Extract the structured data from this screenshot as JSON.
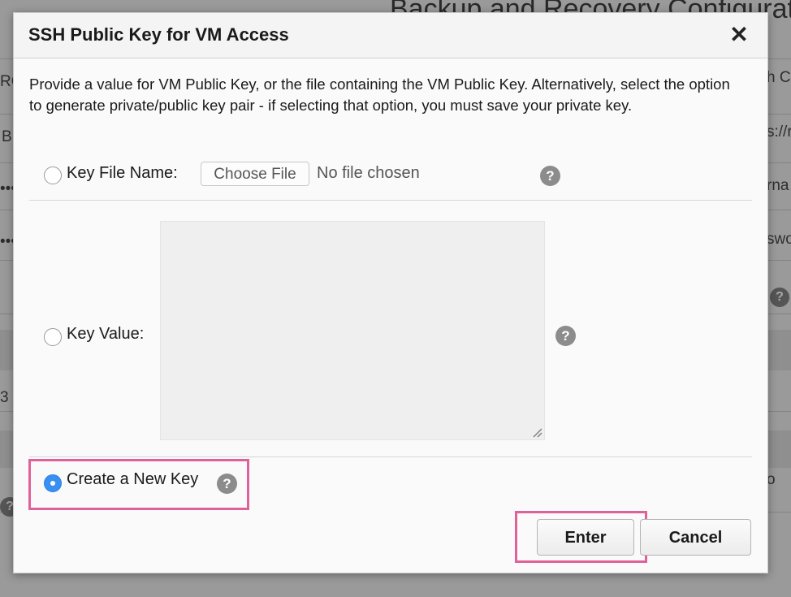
{
  "background": {
    "title_fragment": "Backup and Recovery Configuratio",
    "fragments": {
      "left_1": "RC",
      "left_2": "B",
      "left_3": "•••",
      "left_4": "•••",
      "left_5": "3 -",
      "right_1": "h C",
      "right_2": "s://r",
      "right_3": "rna",
      "right_4": "swo",
      "right_5": "o"
    },
    "help_glyph": "?"
  },
  "dialog": {
    "title": "SSH Public Key for VM Access",
    "close_glyph": "✕",
    "description": "Provide a value for VM Public Key, or the file containing the VM Public Key. Alternatively, select the option to generate private/public key pair - if selecting that option, you must save your private key.",
    "key_file": {
      "label": "Key File Name:",
      "button_label": "Choose File",
      "status": "No file chosen",
      "help_glyph": "?",
      "selected": false
    },
    "key_value": {
      "label": "Key Value:",
      "value": "",
      "help_glyph": "?",
      "selected": false
    },
    "new_key": {
      "label": "Create a New Key",
      "help_glyph": "?",
      "selected": true
    },
    "buttons": {
      "enter": "Enter",
      "cancel": "Cancel"
    }
  },
  "colors": {
    "radio_selected": "#3a8ff2",
    "highlight": "#e0619a"
  },
  "icons": [
    "close-icon",
    "help-icon",
    "resize-grip-icon"
  ]
}
